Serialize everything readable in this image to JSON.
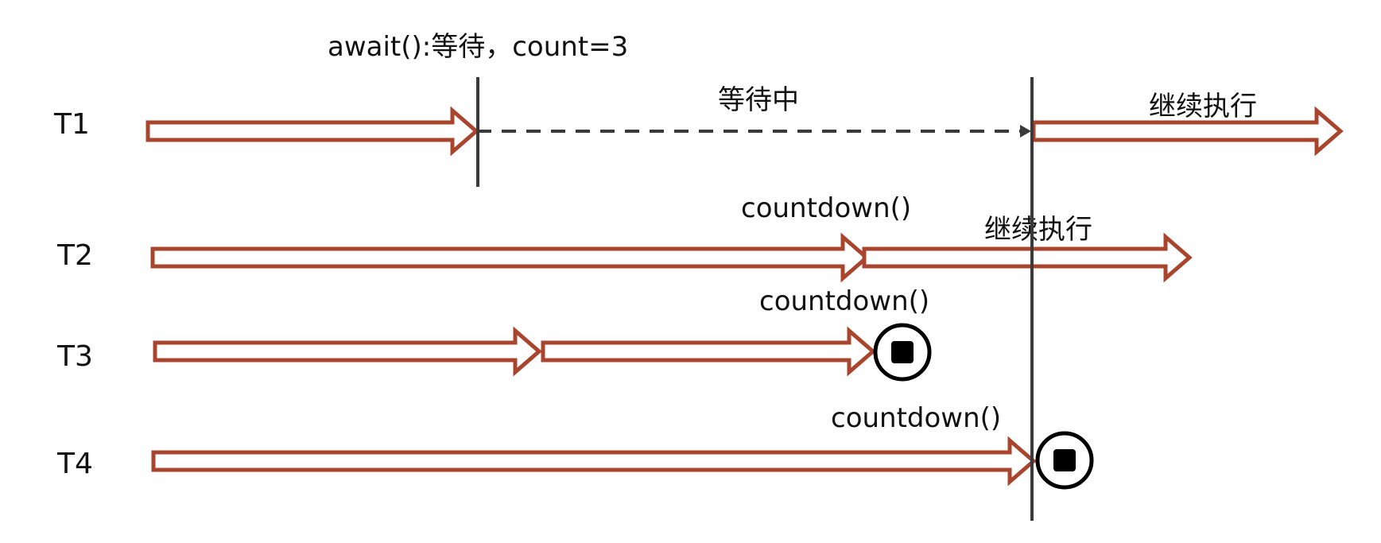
{
  "colors": {
    "arrow_stroke": "#a8452c",
    "arrow_fill": "#ffffff",
    "barrier_line": "#3a3a3a",
    "dashed_line": "#3a3a3a",
    "text": "#111111",
    "terminator": "#000000"
  },
  "labels": {
    "await_call": "await():等待，count=3",
    "waiting": "等待中",
    "t1_continue": "继续执行",
    "t2_countdown": "countdown()",
    "t2_continue": "继续执行",
    "t3_countdown": "countdown()",
    "t4_countdown": "countdown()"
  },
  "threads": [
    "T1",
    "T2",
    "T3",
    "T4"
  ],
  "icons": {
    "terminator": "stop-circle-icon"
  }
}
